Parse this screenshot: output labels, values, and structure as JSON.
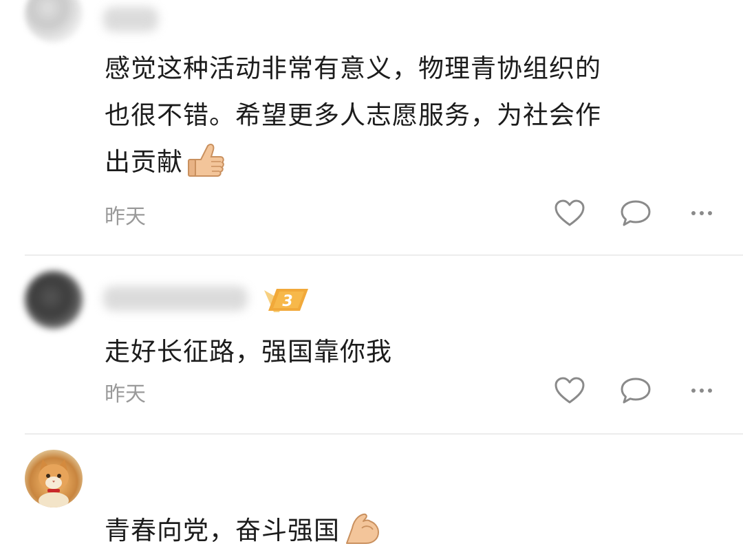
{
  "comments": [
    {
      "text_lines": [
        "感觉这种活动非常有意义，物理青协组织的",
        "也很不错。希望更多人志愿服务，为社会作",
        "出贡献"
      ],
      "emoji": "thumbs-up",
      "time": "昨天"
    },
    {
      "level_badge": "3",
      "text": "走好长征路，强国靠你我",
      "time": "昨天"
    },
    {
      "text": "青春向党，奋斗强国",
      "emoji": "flexed-biceps"
    }
  ]
}
